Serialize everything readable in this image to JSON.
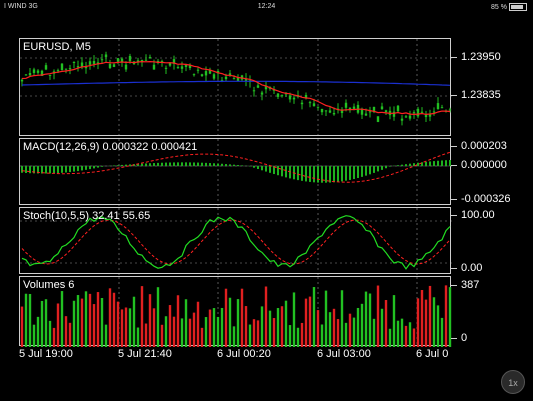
{
  "status_bar": {
    "carrier": "I WIND 3G",
    "time": "12:24",
    "battery": "85 %"
  },
  "chart": {
    "symbol_label": "EURUSD, M5",
    "price_axis": [
      "1.23950",
      "1.23835"
    ],
    "macd": {
      "label": "MACD(12,26,9) 0.000322 0.000421",
      "axis": [
        "0.000203",
        "0.000000",
        "-0.000326"
      ]
    },
    "stoch": {
      "label": "Stoch(10,5,5) 32.41 55.65",
      "axis": [
        "100.00",
        "0.00"
      ]
    },
    "volumes": {
      "label": "Volumes 6",
      "axis": [
        "387",
        "0"
      ]
    },
    "time_axis": [
      "5 Jul 19:00",
      "5 Jul 21:40",
      "6 Jul 00:20",
      "6 Jul 03:00",
      "6 Jul 0"
    ]
  },
  "zoom_label": "1x",
  "colors": {
    "bull": "#22c022",
    "bear": "#e02020",
    "ma_red": "#ff2020",
    "ma_blue": "#1a2fd0",
    "macd_hist": "#1fb01f",
    "stoch_main": "#22dd22",
    "grid": "#cfcfcf",
    "background": "#000000"
  }
}
